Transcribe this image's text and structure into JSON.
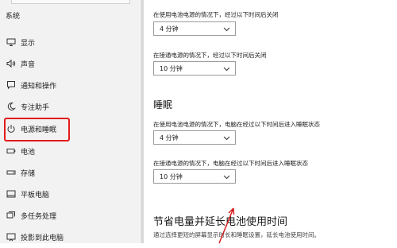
{
  "sidebar": {
    "section_title": "系统",
    "items": [
      {
        "label": "显示",
        "icon": "monitor-icon"
      },
      {
        "label": "声音",
        "icon": "speaker-icon"
      },
      {
        "label": "通知和操作",
        "icon": "message-icon"
      },
      {
        "label": "专注助手",
        "icon": "moon-icon"
      },
      {
        "label": "电源和睡眠",
        "icon": "power-icon"
      },
      {
        "label": "电池",
        "icon": "battery-icon"
      },
      {
        "label": "存储",
        "icon": "storage-icon"
      },
      {
        "label": "平板电脑",
        "icon": "tablet-icon"
      },
      {
        "label": "多任务处理",
        "icon": "multitask-icon"
      },
      {
        "label": "投影到此电脑",
        "icon": "project-icon"
      }
    ],
    "highlight_color": "#e21b1b"
  },
  "screen": {
    "battery_caption": "在使用电池电源的情况下，经过以下时间后关闭",
    "battery_value": "4 分钟",
    "plugged_caption": "在接通电源的情况下，经过以下时间后关闭",
    "plugged_value": "10 分钟"
  },
  "sleep": {
    "heading": "睡眠",
    "battery_caption": "在使用电池电源的情况下，电脑在经过以下时间后进入睡眠状态",
    "battery_value": "4 分钟",
    "plugged_caption": "在接通电源的情况下，电脑在经过以下时间后进入睡眠状态",
    "plugged_value": "10 分钟"
  },
  "save_power": {
    "heading": "节省电量并延长电池使用时间",
    "description": "通过选择更短的屏幕显示时长和睡眠设置，延长电池使用时间。"
  }
}
